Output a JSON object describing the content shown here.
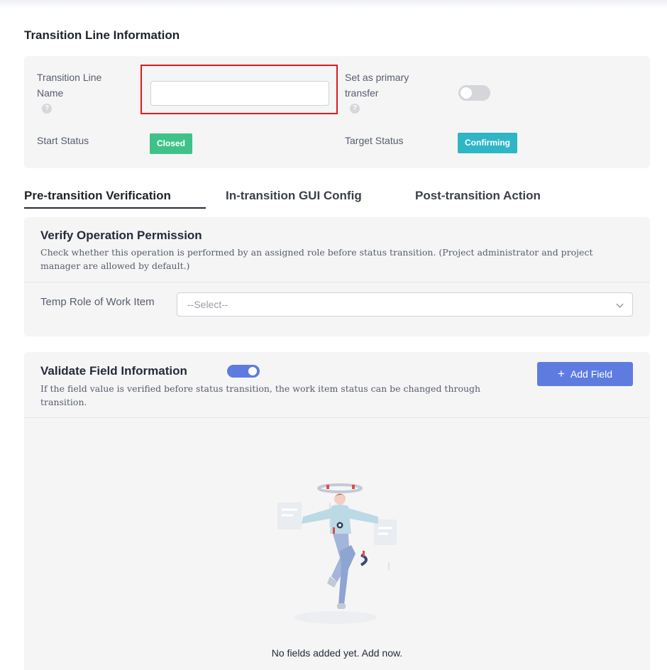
{
  "section": {
    "title": "Transition Line Information"
  },
  "info": {
    "name_label": "Transition Line Name",
    "name_value": "",
    "primary_label": "Set as primary transfer",
    "primary_enabled": false,
    "start_label": "Start Status",
    "start_value": "Closed",
    "target_label": "Target Status",
    "target_value": "Confirming",
    "help_icon": "?"
  },
  "tabs": [
    {
      "label": "Pre-transition Verification",
      "active": true
    },
    {
      "label": "In-transition GUI Config",
      "active": false
    },
    {
      "label": "Post-transition Action",
      "active": false
    }
  ],
  "verify": {
    "title": "Verify Operation Permission",
    "desc": "Check whether this operation is performed by an assigned role before status transition. (Project administrator and project manager are allowed by default.)",
    "role_label": "Temp Role of Work Item",
    "select_placeholder": "--Select--"
  },
  "validate": {
    "title": "Validate Field Information",
    "enabled": true,
    "desc": "If the field value is verified before status transition, the work item status can be changed through transition.",
    "add_button": "Add Field",
    "add_icon": "+",
    "empty_text": "No fields added yet. Add now."
  },
  "colors": {
    "closed": "#3fc28a",
    "confirming": "#2eb6c6",
    "accent": "#5e7ce0",
    "highlight": "#e0191c"
  }
}
